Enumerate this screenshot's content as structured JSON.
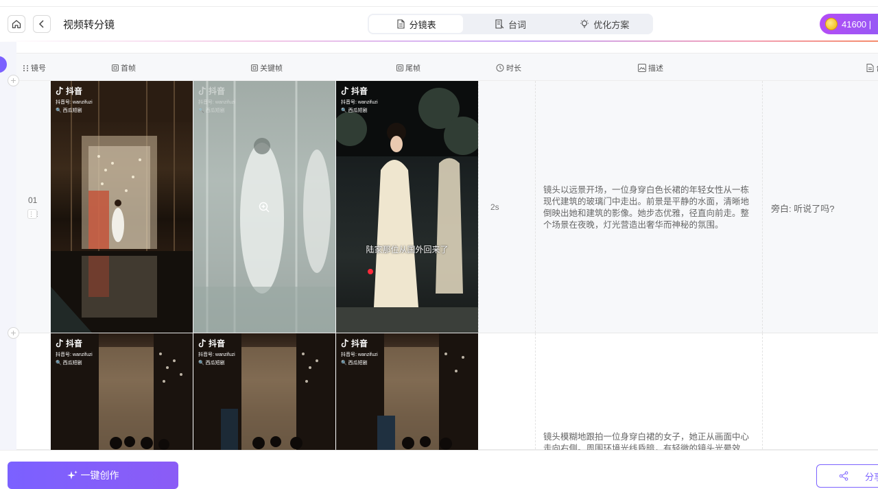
{
  "header": {
    "page_title": "视频转分镜",
    "tabs": [
      {
        "label": "分镜表",
        "active": true
      },
      {
        "label": "台词",
        "active": false
      },
      {
        "label": "优化方案",
        "active": false
      }
    ],
    "credits": "41600 |"
  },
  "table": {
    "columns": [
      "镜号",
      "首帧",
      "关键帧",
      "尾帧",
      "时长",
      "描述",
      "台"
    ],
    "rows": [
      {
        "number": "01",
        "duration": "2s",
        "description": "镜头以远景开场，一位身穿白色长裙的年轻女性从一栋现代建筑的玻璃门中走出。前景是平静的水面，清晰地倒映出她和建筑的影像。她步态优雅，径直向前走。整个场景在夜晚，灯光营造出奢华而神秘的氛围。",
        "dialogue": "旁白: 听说了吗?",
        "caption": "陆家那位从国外回来了"
      },
      {
        "number": "",
        "duration": "",
        "description": "镜头模糊地跟拍一位身穿白裙的女子，她正从画面中心走向右侧。周围环境光线昏暗，有轻微的镜头光晕效",
        "dialogue": ""
      }
    ],
    "watermark": {
      "brand": "抖音",
      "account": "抖音号: wanzifuzi",
      "search": "西瓜短剧"
    }
  },
  "footer": {
    "create_label": "一键创作",
    "share_label": "分享"
  },
  "colors": {
    "accent": "#7b61ff",
    "credit_pill": "#a855f7"
  }
}
